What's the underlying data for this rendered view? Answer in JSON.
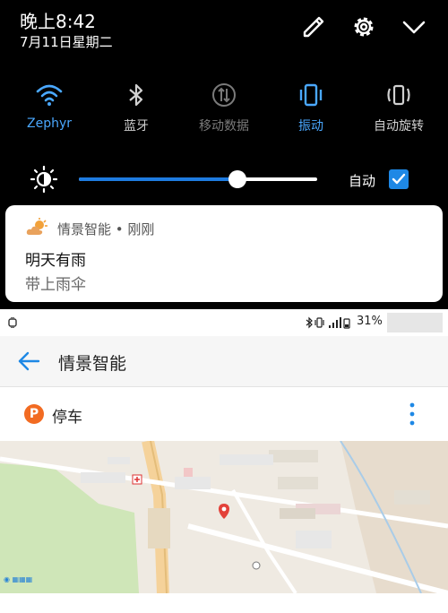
{
  "status": {
    "time": "晚上8:42",
    "date": "7月11日星期二"
  },
  "header_icons": [
    "edit-icon",
    "settings-icon",
    "chevron-down-icon"
  ],
  "quick_settings": [
    {
      "label": "Zephyr",
      "icon": "wifi-icon",
      "state": "active"
    },
    {
      "label": "蓝牙",
      "icon": "bluetooth-icon",
      "state": "inactive"
    },
    {
      "label": "移动数据",
      "icon": "mobile-data-icon",
      "state": "disabled"
    },
    {
      "label": "振动",
      "icon": "vibrate-icon",
      "state": "active"
    },
    {
      "label": "自动旋转",
      "icon": "rotate-icon",
      "state": "inactive"
    }
  ],
  "brightness": {
    "level": 0.67,
    "auto_label": "自动",
    "auto_checked": true
  },
  "notification": {
    "app": "情景智能 • 刚刚",
    "title": "明天有雨",
    "text": "带上雨伞",
    "icon": "weather-cloud-sun-icon"
  },
  "app_status_bar": {
    "battery": "31%"
  },
  "app": {
    "title": "情景智能",
    "card_title": "停车",
    "card_icon_letter": "P"
  },
  "colors": {
    "accent": "#1e88e5",
    "shade_bg": "#000000",
    "parking_orange": "#f26b22",
    "active_text": "#4aa8ff",
    "inactive_text": "#d0d0d0",
    "disabled_text": "#7a7a7a"
  }
}
